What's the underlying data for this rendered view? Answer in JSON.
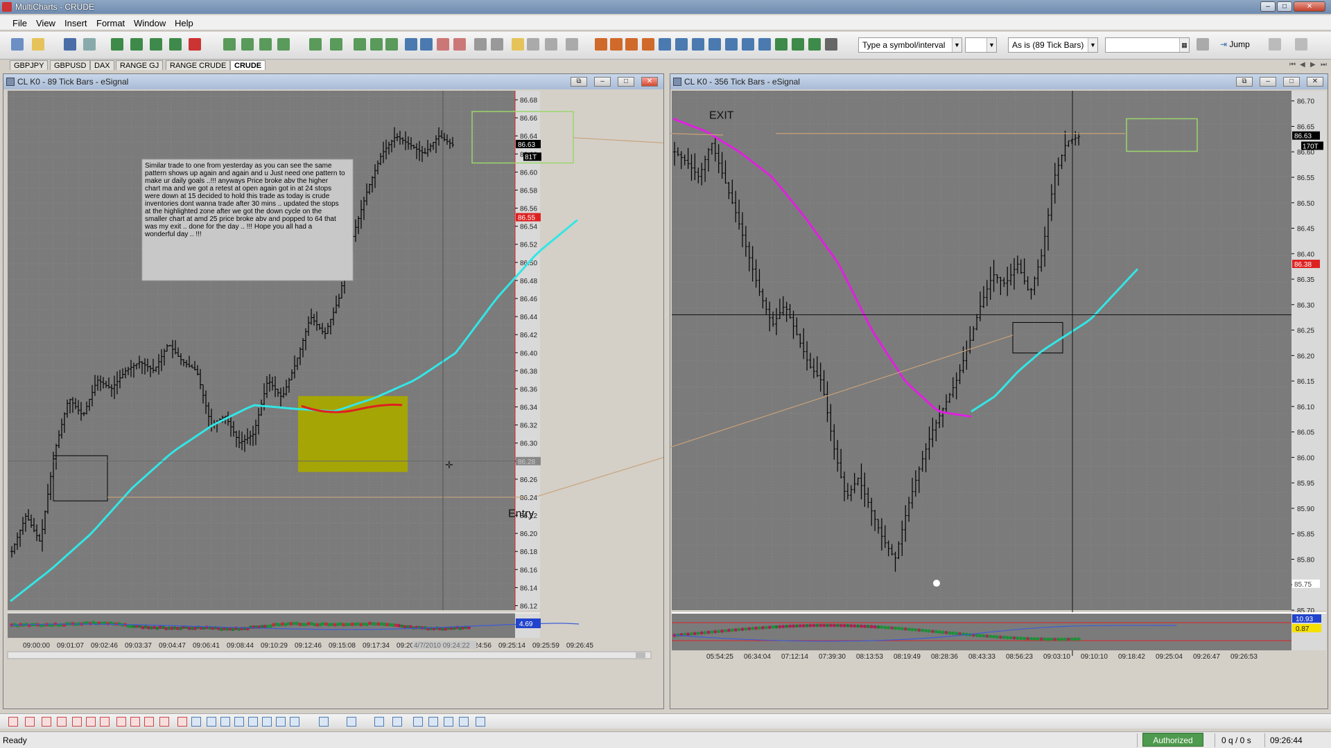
{
  "app": {
    "title": "MultiCharts - CRUDE"
  },
  "menu": [
    "File",
    "View",
    "Insert",
    "Format",
    "Window",
    "Help"
  ],
  "toolbar": {
    "symbol_placeholder": "Type a symbol/interval",
    "interval_value": "As is (89 Tick Bars)",
    "jump_label": "Jump"
  },
  "workspaces": [
    {
      "label": "GBPJPY",
      "active": false
    },
    {
      "label": "GBPUSD",
      "active": false
    },
    {
      "label": "DAX",
      "active": false
    },
    {
      "label": "RANGE GJ",
      "active": false
    },
    {
      "label": "RANGE CRUDE",
      "active": false
    },
    {
      "label": "CRUDE",
      "active": true
    }
  ],
  "left_chart": {
    "title": "CL K0 - 89 Tick Bars - eSignal",
    "note": "Similar trade to one from yesterday as you can see the same pattern shows up again and again and u Just need one pattern to make ur daily goals ..!!! anyways Price broke abv the higher chart ma and we got a retest at open again got in at 24 stops were down at 15 decided to hold this trade as today is crude inventories dont wanna trade after 30 mins .. updated the stops at the highlighted zone after we got the down cycle on the smaller chart at amd 25 price broke abv and popped to 64 that was my exit .. done for the day .. !!! Hope you all had a wonderful day .. !!!",
    "entry_label": "Entry",
    "price_ticks": [
      "86.68",
      "86.66",
      "86.64",
      "86.62",
      "86.60",
      "86.58",
      "86.56",
      "86.54",
      "86.52",
      "86.50",
      "86.48",
      "86.46",
      "86.44",
      "86.42",
      "86.40",
      "86.38",
      "86.36",
      "86.34",
      "86.32",
      "86.30",
      "86.28",
      "86.26",
      "86.24",
      "86.22",
      "86.20",
      "86.18",
      "86.16",
      "86.14",
      "86.12"
    ],
    "last_price": "86.63",
    "tick_badge": "81T",
    "red_price": "86.55",
    "cursor_price": "86.28",
    "cursor_date": "4/7/2010 09:24:22",
    "time_ticks": [
      "09:00:00",
      "09:01:07",
      "09:02:46",
      "09:03:37",
      "09:04:47",
      "09:06:41",
      "09:08:44",
      "09:10:29",
      "09:12:46",
      "09:15:08",
      "09:17:34",
      "09:20:",
      "39",
      "09:24:56",
      "09:25:14",
      "09:25:59",
      "09:26:45"
    ],
    "indicator_value": "4.69"
  },
  "right_chart": {
    "title": "CL K0 - 356 Tick Bars - eSignal",
    "exit_label": "EXIT",
    "price_ticks": [
      "86.70",
      "86.65",
      "86.60",
      "86.55",
      "86.50",
      "86.45",
      "86.40",
      "86.35",
      "86.30",
      "86.25",
      "86.20",
      "86.15",
      "86.10",
      "86.05",
      "86.00",
      "85.95",
      "85.90",
      "85.85",
      "85.80",
      "85.75",
      "85.70"
    ],
    "last_price": "86.63",
    "tick_badge": "170T",
    "red_price": "86.38",
    "low_price": "85.75",
    "time_ticks": [
      "05:54:25",
      "06:34:04",
      "07:12:14",
      "07:39:30",
      "08:13:53",
      "08:19:49",
      "08:28:36",
      "08:43:33",
      "08:56:23",
      "09:03:10",
      "09:10:10",
      "09:18:42",
      "09:25:04",
      "09:26:47",
      "09:26:53"
    ],
    "indicator_values": [
      "10.93",
      "0.87"
    ]
  },
  "status": {
    "ready": "Ready",
    "authorized": "Authorized",
    "quotes": "0 q / 0 s",
    "clock": "09:26:44"
  },
  "colors": {
    "chart_bg": "#7b7b7b",
    "ma_fast": "#33e6e6",
    "ma_slow": "#e020e0",
    "zone": "#a8a800",
    "price_axis": "#d9d9d9"
  }
}
